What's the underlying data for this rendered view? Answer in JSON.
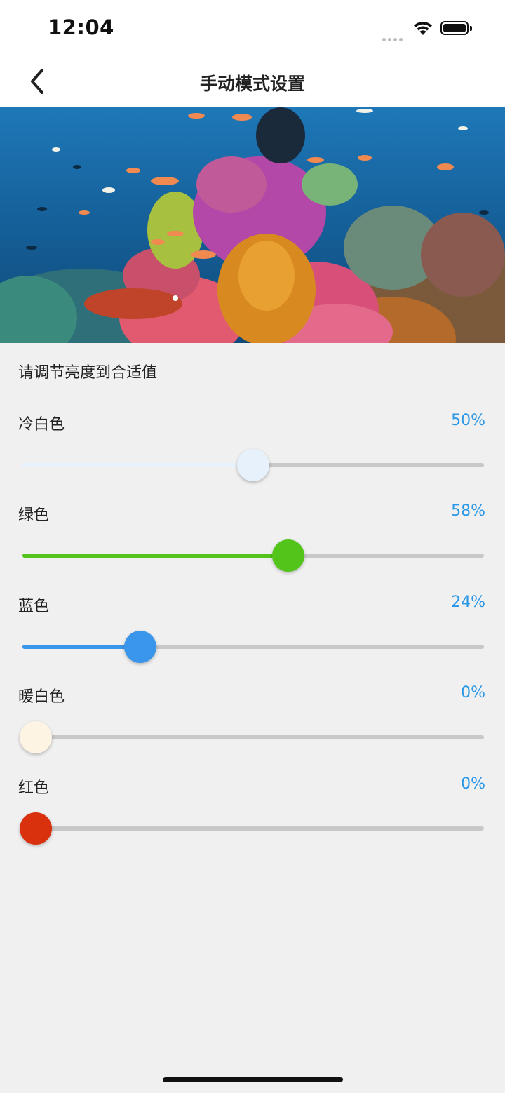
{
  "status_bar": {
    "time": "12:04"
  },
  "nav": {
    "title": "手动模式设置"
  },
  "banner": {
    "alt": "coral-reef-photo"
  },
  "hint": "请调节亮度到合适值",
  "sliders": [
    {
      "label": "冷白色",
      "value_text": "50%",
      "fraction": 0.5,
      "fill_color": "#e8f2fc",
      "thumb_color": "#e6f1fc"
    },
    {
      "label": "绿色",
      "value_text": "58%",
      "fraction": 0.58,
      "fill_color": "#52c41a",
      "thumb_color": "#52c41a"
    },
    {
      "label": "蓝色",
      "value_text": "24%",
      "fraction": 0.24,
      "fill_color": "#3a96ea",
      "thumb_color": "#3a96ea"
    },
    {
      "label": "暖白色",
      "value_text": "0%",
      "fraction": 0.0,
      "fill_color": "#fdf3e2",
      "thumb_color": "#fdf4e4"
    },
    {
      "label": "红色",
      "value_text": "0%",
      "fraction": 0.0,
      "fill_color": "#d9300d",
      "thumb_color": "#d9300d"
    }
  ],
  "colors": {
    "accent": "#2a97e6",
    "background": "#f0f0f0",
    "track": "#c8c8c8"
  }
}
